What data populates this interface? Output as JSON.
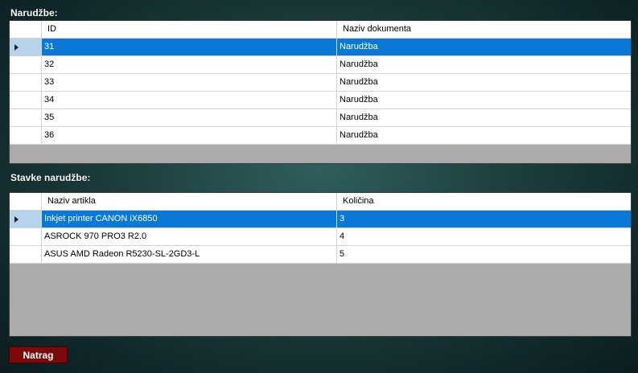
{
  "orders": {
    "label": "Narudžbe:",
    "columns": [
      "ID",
      "Naziv dokumenta"
    ],
    "rows": [
      {
        "id": "31",
        "name": "Narudžba"
      },
      {
        "id": "32",
        "name": "Narudžba"
      },
      {
        "id": "33",
        "name": "Narudžba"
      },
      {
        "id": "34",
        "name": "Narudžba"
      },
      {
        "id": "35",
        "name": "Narudžba"
      },
      {
        "id": "36",
        "name": "Narudžba"
      }
    ]
  },
  "items": {
    "label": "Stavke narudžbe:",
    "columns": [
      "Naziv artikla",
      "Količina"
    ],
    "rows": [
      {
        "name": "Inkjet printer CANON iX6850",
        "qty": "3"
      },
      {
        "name": "ASROCK 970 PRO3 R2.0",
        "qty": "4"
      },
      {
        "name": "ASUS AMD Radeon R5230-SL-2GD3-L",
        "qty": "5"
      }
    ]
  },
  "buttons": {
    "back": "Natrag"
  },
  "colors": {
    "selection": "#0a78d7",
    "grid_empty": "#ababab",
    "button_back": "#7d0a0a"
  },
  "icons": {
    "current_row": "row-pointer-icon"
  }
}
